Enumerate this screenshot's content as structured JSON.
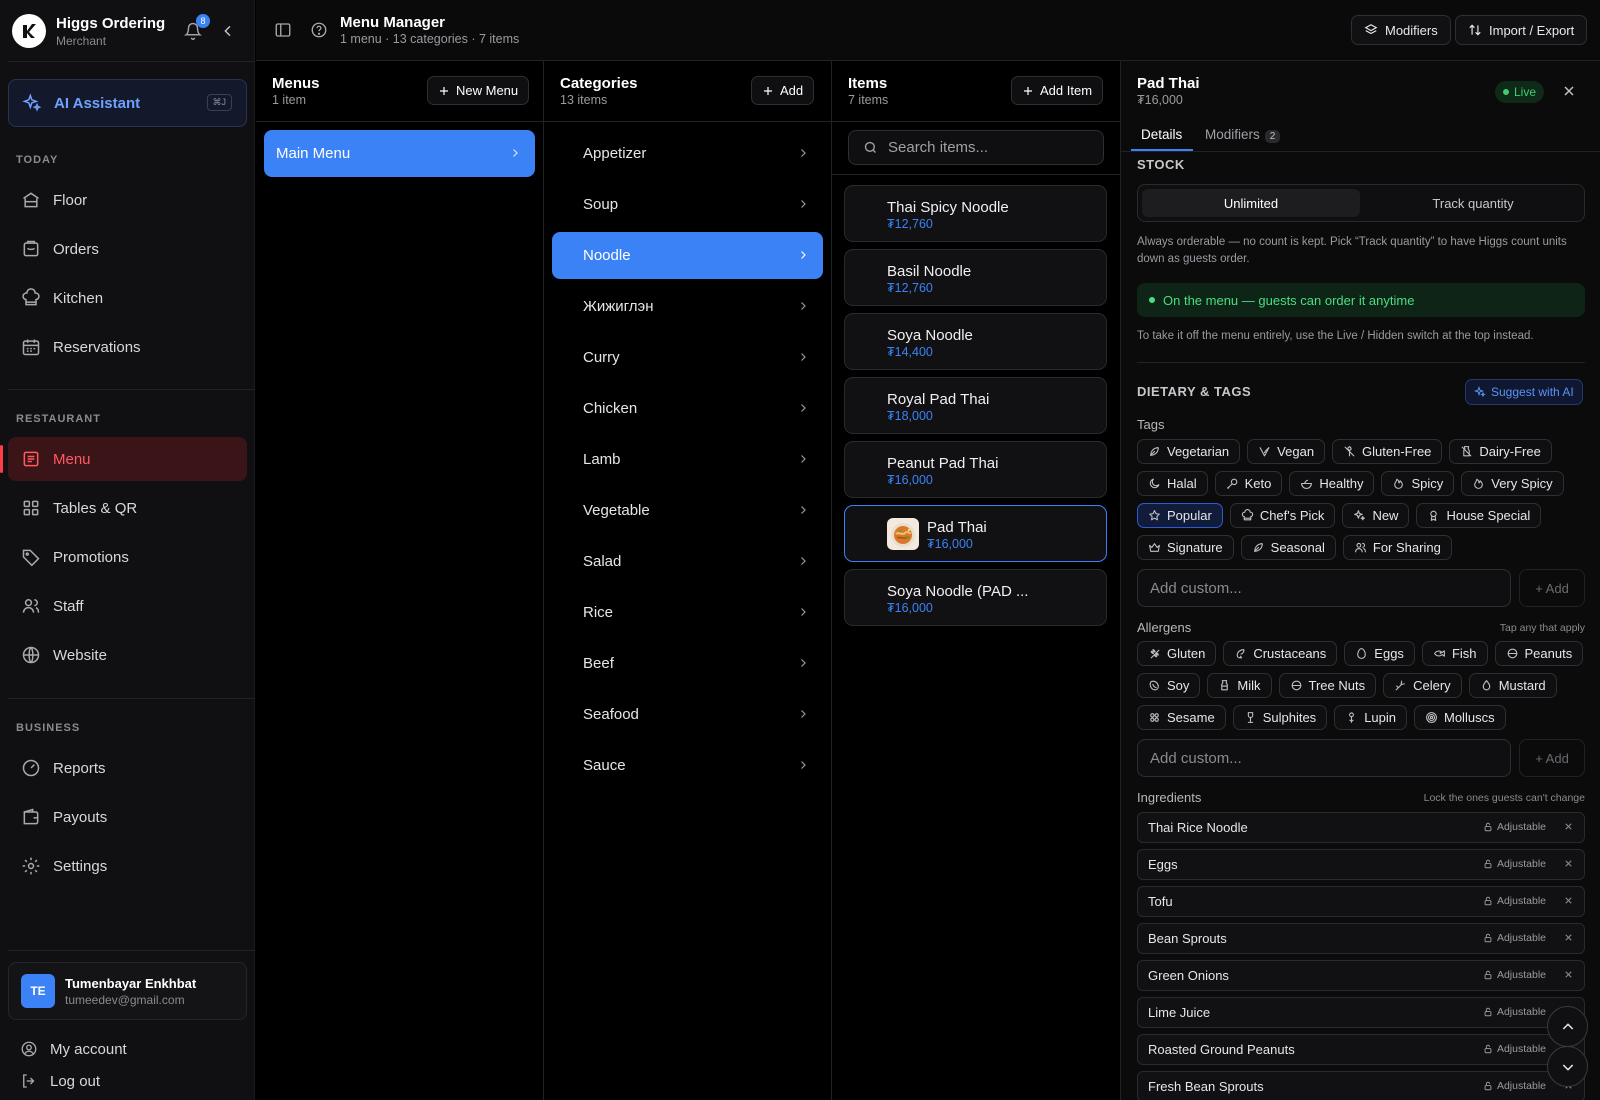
{
  "brand": {
    "name": "Higgs Ordering",
    "role": "Merchant",
    "notifications": "8"
  },
  "ai": {
    "label": "AI Assistant",
    "shortcut": "⌘J"
  },
  "nav": {
    "today_label": "TODAY",
    "today": [
      {
        "label": "Floor",
        "icon": "floor-icon"
      },
      {
        "label": "Orders",
        "icon": "orders-icon"
      },
      {
        "label": "Kitchen",
        "icon": "kitchen-icon"
      },
      {
        "label": "Reservations",
        "icon": "calendar-icon"
      }
    ],
    "restaurant_label": "RESTAURANT",
    "restaurant": [
      {
        "label": "Menu",
        "icon": "menu-icon",
        "active": true
      },
      {
        "label": "Tables & QR",
        "icon": "grid-icon"
      },
      {
        "label": "Promotions",
        "icon": "tag-icon"
      },
      {
        "label": "Staff",
        "icon": "users-icon"
      },
      {
        "label": "Website",
        "icon": "globe-icon"
      }
    ],
    "business_label": "BUSINESS",
    "business": [
      {
        "label": "Reports",
        "icon": "gauge-icon"
      },
      {
        "label": "Payouts",
        "icon": "wallet-icon"
      },
      {
        "label": "Settings",
        "icon": "gear-icon"
      }
    ]
  },
  "user": {
    "initials": "TE",
    "name": "Tumenbayar Enkhbat",
    "email": "tumeedev@gmail.com"
  },
  "account": {
    "my_account": "My account",
    "logout": "Log out"
  },
  "header": {
    "title": "Menu Manager",
    "subtitle": "1 menu · 13 categories · 7 items",
    "modifiers": "Modifiers",
    "import_export": "Import / Export"
  },
  "menus": {
    "title": "Menus",
    "count": "1 item",
    "new_label": "New Menu",
    "items": [
      "Main Menu"
    ]
  },
  "categories": {
    "title": "Categories",
    "count": "13 items",
    "add_label": "Add",
    "items": [
      "Appetizer",
      "Soup",
      "Noodle",
      "Жижиглэн",
      "Curry",
      "Chicken",
      "Lamb",
      "Vegetable",
      "Salad",
      "Rice",
      "Beef",
      "Seafood",
      "Sauce"
    ],
    "active": "Noodle"
  },
  "items": {
    "title": "Items",
    "count": "7 items",
    "add_label": "Add Item",
    "search_placeholder": "Search items...",
    "list": [
      {
        "name": "Thai Spicy Noodle",
        "price": "₮12,760"
      },
      {
        "name": "Basil Noodle",
        "price": "₮12,760"
      },
      {
        "name": "Soya Noodle",
        "price": "₮14,400"
      },
      {
        "name": "Royal Pad Thai",
        "price": "₮18,000"
      },
      {
        "name": "Peanut Pad Thai",
        "price": "₮16,000"
      },
      {
        "name": "Pad Thai",
        "price": "₮16,000",
        "selected": true
      },
      {
        "name": "Soya Noodle (PAD ...",
        "price": "₮16,000"
      }
    ]
  },
  "detail": {
    "title": "Pad Thai",
    "price": "₮16,000",
    "status": "Live",
    "tabs": {
      "details": "Details",
      "modifiers": "Modifiers",
      "modifiers_count": "2"
    },
    "stock": {
      "label": "STOCK",
      "unlimited": "Unlimited",
      "track": "Track quantity",
      "note": "Always orderable — no count is kept. Pick “Track quantity” to have Higgs count units down as guests order.",
      "on_menu": "On the menu — guests can order it anytime",
      "take_off": "To take it off the menu entirely, use the Live / Hidden switch at the top instead."
    },
    "dietary": {
      "label": "DIETARY & TAGS",
      "suggest": "Suggest with AI",
      "tags_label": "Tags",
      "tags": [
        {
          "label": "Vegetarian",
          "icon": "leaf-icon"
        },
        {
          "label": "Vegan",
          "icon": "vegan-icon"
        },
        {
          "label": "Gluten-Free",
          "icon": "wheat-off-icon"
        },
        {
          "label": "Dairy-Free",
          "icon": "milk-off-icon"
        },
        {
          "label": "Halal",
          "icon": "moon-icon"
        },
        {
          "label": "Keto",
          "icon": "drumstick-icon"
        },
        {
          "label": "Healthy",
          "icon": "salad-icon"
        },
        {
          "label": "Spicy",
          "icon": "flame-icon"
        },
        {
          "label": "Very Spicy",
          "icon": "flame-icon"
        },
        {
          "label": "Popular",
          "icon": "star-icon",
          "selected": true
        },
        {
          "label": "Chef's Pick",
          "icon": "chef-hat-icon"
        },
        {
          "label": "New",
          "icon": "sparkles-icon"
        },
        {
          "label": "House Special",
          "icon": "award-icon"
        },
        {
          "label": "Signature",
          "icon": "crown-icon"
        },
        {
          "label": "Seasonal",
          "icon": "leaf-icon"
        },
        {
          "label": "For Sharing",
          "icon": "users-icon"
        }
      ],
      "custom_placeholder": "Add custom...",
      "add_label": "+ Add",
      "allergens_label": "Allergens",
      "allergens_hint": "Tap any that apply",
      "allergens": [
        {
          "label": "Gluten",
          "icon": "wheat-icon"
        },
        {
          "label": "Crustaceans",
          "icon": "shrimp-icon"
        },
        {
          "label": "Eggs",
          "icon": "egg-icon"
        },
        {
          "label": "Fish",
          "icon": "fish-icon"
        },
        {
          "label": "Peanuts",
          "icon": "nut-icon"
        },
        {
          "label": "Soy",
          "icon": "bean-icon"
        },
        {
          "label": "Milk",
          "icon": "milk-icon"
        },
        {
          "label": "Tree Nuts",
          "icon": "nut-icon"
        },
        {
          "label": "Celery",
          "icon": "carrot-icon"
        },
        {
          "label": "Mustard",
          "icon": "droplet-icon"
        },
        {
          "label": "Sesame",
          "icon": "sesame-icon"
        },
        {
          "label": "Sulphites",
          "icon": "wine-icon"
        },
        {
          "label": "Lupin",
          "icon": "flower-icon"
        },
        {
          "label": "Molluscs",
          "icon": "shell-icon"
        }
      ],
      "allergen_custom_placeholder": "Add custom...",
      "ingredients_label": "Ingredients",
      "ingredients_hint": "Lock the ones guests can't change",
      "ingredients": [
        {
          "name": "Thai Rice Noodle",
          "state": "Adjustable"
        },
        {
          "name": "Eggs",
          "state": "Adjustable"
        },
        {
          "name": "Tofu",
          "state": "Adjustable"
        },
        {
          "name": "Bean Sprouts",
          "state": "Adjustable"
        },
        {
          "name": "Green Onions",
          "state": "Adjustable"
        },
        {
          "name": "Lime Juice",
          "state": "Adjustable"
        },
        {
          "name": "Roasted Ground Peanuts",
          "state": "Adjustable"
        },
        {
          "name": "Fresh Bean Sprouts",
          "state": "Adjustable"
        }
      ]
    }
  },
  "colors": {
    "accent": "#3b82f6",
    "danger": "#ff5a62",
    "live": "#3fcf6e"
  }
}
